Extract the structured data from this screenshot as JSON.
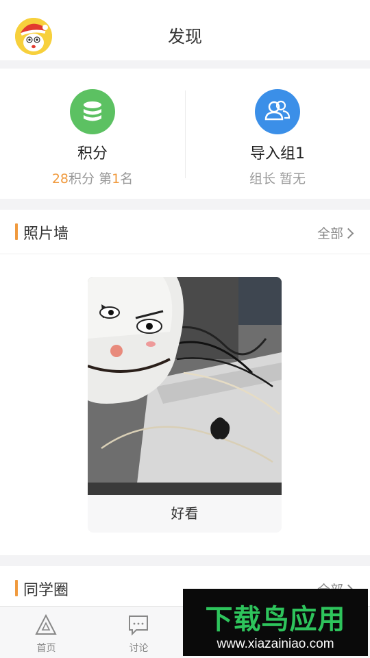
{
  "header": {
    "title": "发现"
  },
  "stats": {
    "points": {
      "title": "积分",
      "count": "28",
      "count_label": "积分",
      "rank_prefix": "第",
      "rank": "1",
      "rank_suffix": "名"
    },
    "group": {
      "title": "导入组1",
      "leader_label": "组长",
      "leader_value": "暂无"
    }
  },
  "photo_wall": {
    "title": "照片墙",
    "more_label": "全部",
    "items": [
      {
        "caption": "好看"
      }
    ]
  },
  "classmates": {
    "title": "同学圈",
    "more_label": "全部"
  },
  "tabbar": {
    "items": [
      {
        "label": "首页",
        "icon": "home-triangle-icon"
      },
      {
        "label": "讨论",
        "icon": "chat-bubble-icon"
      }
    ]
  },
  "watermark": {
    "title": "下载鸟应用",
    "url": "www.xiazainiao.com"
  },
  "colors": {
    "accent": "#f09a3e",
    "points_green": "#5cc162",
    "group_blue": "#3b8fe8",
    "watermark_green": "#2ec45c"
  }
}
